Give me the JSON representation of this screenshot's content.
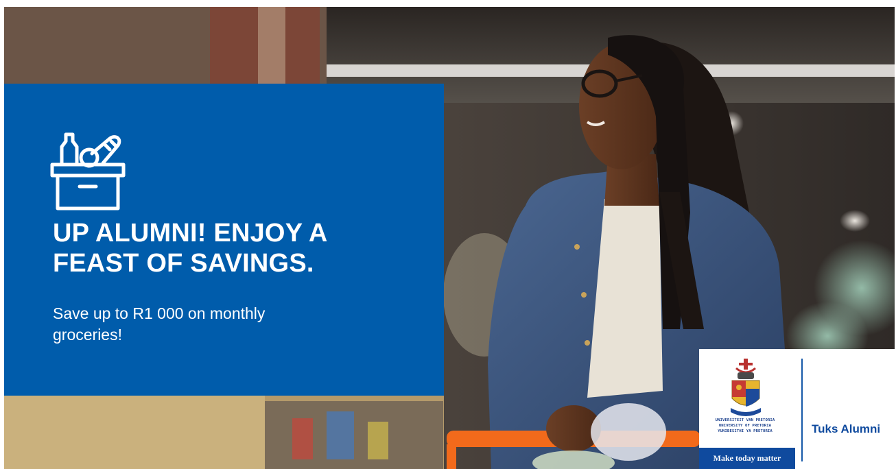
{
  "promo": {
    "headline_line1": "UP ALUMNI! ENJOY A",
    "headline_line2": "FEAST OF SAVINGS.",
    "subline_line1": "Save up to R1 000 on monthly",
    "subline_line2": "groceries!",
    "icon": "grocery-box-icon"
  },
  "logo": {
    "name_af": "UNIVERSITEIT VAN PRETORIA",
    "name_en": "UNIVERSITY OF PRETORIA",
    "name_zu": "YUNIBESITHI YA PRETORIA",
    "tagline": "Make today matter",
    "brand": "Tuks Alumni",
    "icon": "university-crest-icon"
  },
  "colors": {
    "brand_blue": "#005cab",
    "logo_blue": "#0f4a9e",
    "trolley_orange": "#f26a1b"
  }
}
